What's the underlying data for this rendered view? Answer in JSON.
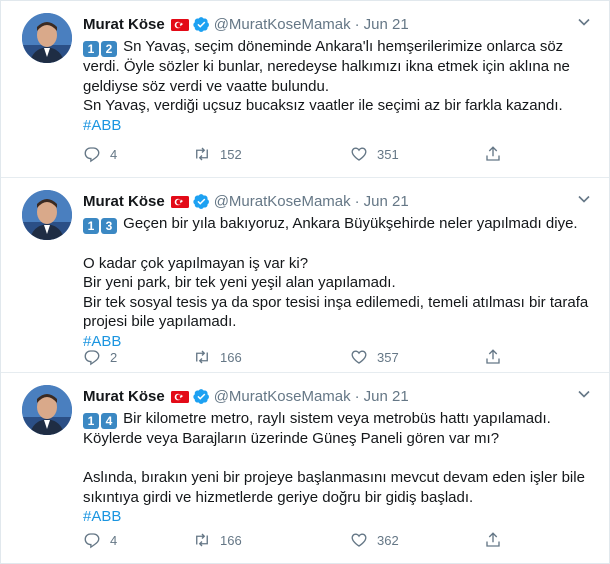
{
  "colors": {
    "link": "#1b95e0",
    "muted": "#657786",
    "verified": "#1da1f2",
    "keycap": "#3b88c3"
  },
  "tweets": [
    {
      "name": "Murat Köse",
      "handle": "@MuratKoseMamak",
      "dot": "·",
      "date": "Jun 21",
      "keycaps": [
        "1",
        "2"
      ],
      "lines": [
        "Sn Yavaş, seçim döneminde Ankara'lı hemşerilerimize onlarca söz",
        "verdi. Öyle sözler ki bunlar, neredeyse halkımızı ikna etmek için aklına ne",
        "geldiyse söz verdi ve vaatte bulundu.",
        "Sn Yavaş, verdiği uçsuz bucaksız vaatler ile seçimi az bir farkla kazandı."
      ],
      "hashtag": "#ABB",
      "replies": "4",
      "retweets": "152",
      "likes": "351"
    },
    {
      "name": "Murat Köse",
      "handle": "@MuratKoseMamak",
      "dot": "·",
      "date": "Jun 21",
      "keycaps": [
        "1",
        "3"
      ],
      "lines": [
        "Geçen bir yıla bakıyoruz, Ankara Büyükşehirde neler yapılmadı diye.",
        "",
        "O kadar çok yapılmayan iş var ki?",
        "Bir yeni park, bir tek yeni yeşil alan yapılamadı.",
        "Bir tek sosyal tesis ya da spor tesisi inşa edilemedi, temeli atılması bir tarafa",
        "projesi bile yapılamadı."
      ],
      "hashtag": "#ABB",
      "replies": "2",
      "retweets": "166",
      "likes": "357"
    },
    {
      "name": "Murat Köse",
      "handle": "@MuratKoseMamak",
      "dot": "·",
      "date": "Jun 21",
      "keycaps": [
        "1",
        "4"
      ],
      "lines": [
        "Bir kilometre metro, raylı sistem veya metrobüs hattı yapılamadı.",
        "Köylerde veya Barajların üzerinde Güneş Paneli gören var mı?",
        "",
        "Aslında, bırakın yeni bir projeye başlanmasını mevcut devam eden işler bile",
        "sıkıntıya girdi ve hizmetlerde geriye doğru bir gidiş başladı."
      ],
      "hashtag": "#ABB",
      "replies": "4",
      "retweets": "166",
      "likes": "362"
    }
  ]
}
